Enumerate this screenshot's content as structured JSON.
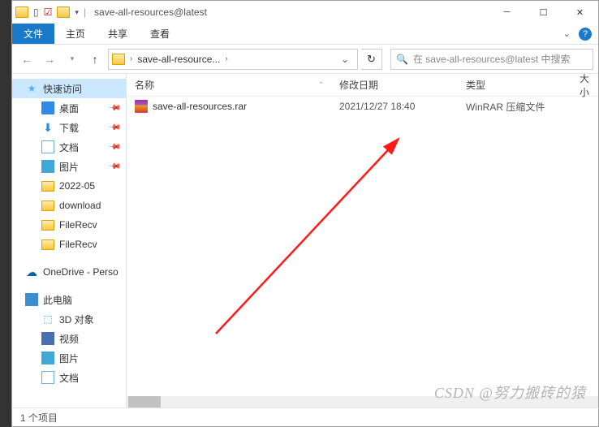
{
  "titlebar": {
    "app_title": "save-all-resources@latest"
  },
  "ribbon": {
    "file": "文件",
    "home": "主页",
    "share": "共享",
    "view": "查看"
  },
  "address": {
    "crumb": "save-all-resource..."
  },
  "search": {
    "placeholder": "在 save-all-resources@latest 中搜索"
  },
  "columns": {
    "name": "名称",
    "date": "修改日期",
    "type": "类型",
    "size": "大小"
  },
  "sidebar": {
    "quick": "快速访问",
    "desktop": "桌面",
    "downloads": "下载",
    "docs": "文档",
    "pics": "图片",
    "f1": "2022-05",
    "f2": "download",
    "f3": "FileRecv",
    "f4": "FileRecv",
    "onedrive": "OneDrive - Perso",
    "thispc": "此电脑",
    "obj3d": "3D 对象",
    "video": "视频",
    "pics2": "图片",
    "docs2": "文档"
  },
  "files": [
    {
      "name": "save-all-resources.rar",
      "date": "2021/12/27 18:40",
      "type": "WinRAR 压缩文件"
    }
  ],
  "status": {
    "count": "1 个项目"
  },
  "watermark": "CSDN @努力搬砖的猿"
}
